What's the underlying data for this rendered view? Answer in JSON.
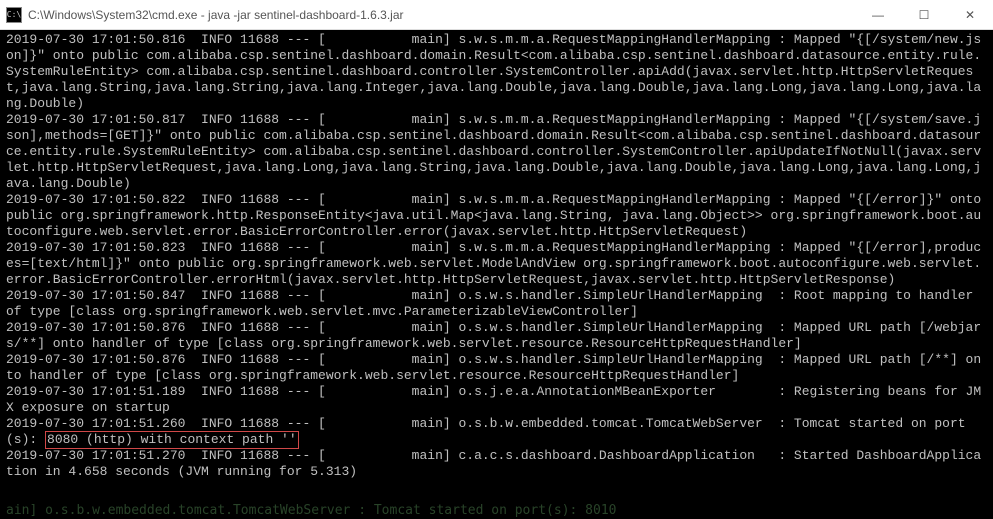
{
  "window": {
    "title": "C:\\Windows\\System32\\cmd.exe - java  -jar sentinel-dashboard-1.6.3.jar",
    "icon": "C:\\"
  },
  "buttons": {
    "min": "—",
    "max": "☐",
    "close": "✕"
  },
  "log": {
    "lines": [
      "2019-07-30 17:01:50.816  INFO 11688 --- [           main] s.w.s.m.m.a.RequestMappingHandlerMapping : Mapped \"{[/system/new.json]}\" onto public com.alibaba.csp.sentinel.dashboard.domain.Result<com.alibaba.csp.sentinel.dashboard.datasource.entity.rule.SystemRuleEntity> com.alibaba.csp.sentinel.dashboard.controller.SystemController.apiAdd(javax.servlet.http.HttpServletRequest,java.lang.String,java.lang.String,java.lang.Integer,java.lang.Double,java.lang.Double,java.lang.Long,java.lang.Long,java.lang.Double)",
      "2019-07-30 17:01:50.817  INFO 11688 --- [           main] s.w.s.m.m.a.RequestMappingHandlerMapping : Mapped \"{[/system/save.json],methods=[GET]}\" onto public com.alibaba.csp.sentinel.dashboard.domain.Result<com.alibaba.csp.sentinel.dashboard.datasource.entity.rule.SystemRuleEntity> com.alibaba.csp.sentinel.dashboard.controller.SystemController.apiUpdateIfNotNull(javax.servlet.http.HttpServletRequest,java.lang.Long,java.lang.String,java.lang.Double,java.lang.Double,java.lang.Long,java.lang.Long,java.lang.Double)",
      "2019-07-30 17:01:50.822  INFO 11688 --- [           main] s.w.s.m.m.a.RequestMappingHandlerMapping : Mapped \"{[/error]}\" onto public org.springframework.http.ResponseEntity<java.util.Map<java.lang.String, java.lang.Object>> org.springframework.boot.autoconfigure.web.servlet.error.BasicErrorController.error(javax.servlet.http.HttpServletRequest)",
      "2019-07-30 17:01:50.823  INFO 11688 --- [           main] s.w.s.m.m.a.RequestMappingHandlerMapping : Mapped \"{[/error],produces=[text/html]}\" onto public org.springframework.web.servlet.ModelAndView org.springframework.boot.autoconfigure.web.servlet.error.BasicErrorController.errorHtml(javax.servlet.http.HttpServletRequest,javax.servlet.http.HttpServletResponse)",
      "2019-07-30 17:01:50.847  INFO 11688 --- [           main] o.s.w.s.handler.SimpleUrlHandlerMapping  : Root mapping to handler of type [class org.springframework.web.servlet.mvc.ParameterizableViewController]",
      "2019-07-30 17:01:50.876  INFO 11688 --- [           main] o.s.w.s.handler.SimpleUrlHandlerMapping  : Mapped URL path [/webjars/**] onto handler of type [class org.springframework.web.servlet.resource.ResourceHttpRequestHandler]",
      "2019-07-30 17:01:50.876  INFO 11688 --- [           main] o.s.w.s.handler.SimpleUrlHandlerMapping  : Mapped URL path [/**] onto handler of type [class org.springframework.web.servlet.resource.ResourceHttpRequestHandler]",
      "2019-07-30 17:01:51.189  INFO 11688 --- [           main] o.s.j.e.a.AnnotationMBeanExporter        : Registering beans for JMX exposure on startup"
    ],
    "highlightLine": {
      "prefix": "2019-07-30 17:01:51.260  INFO 11688 --- [           main] o.s.b.w.embedded.tomcat.TomcatWebServer  : Tomcat started on port(s): ",
      "highlighted": "8080 (http) with context path ''",
      "suffix": ""
    },
    "finalLine": "2019-07-30 17:01:51.270  INFO 11688 --- [           main] c.a.c.s.dashboard.DashboardApplication   : Started DashboardApplication in 4.658 seconds (JVM running for 5.313)"
  },
  "ghost": "ain] o.s.b.w.embedded.tomcat.TomcatWebServer   : Tomcat started on port(s): 8010"
}
